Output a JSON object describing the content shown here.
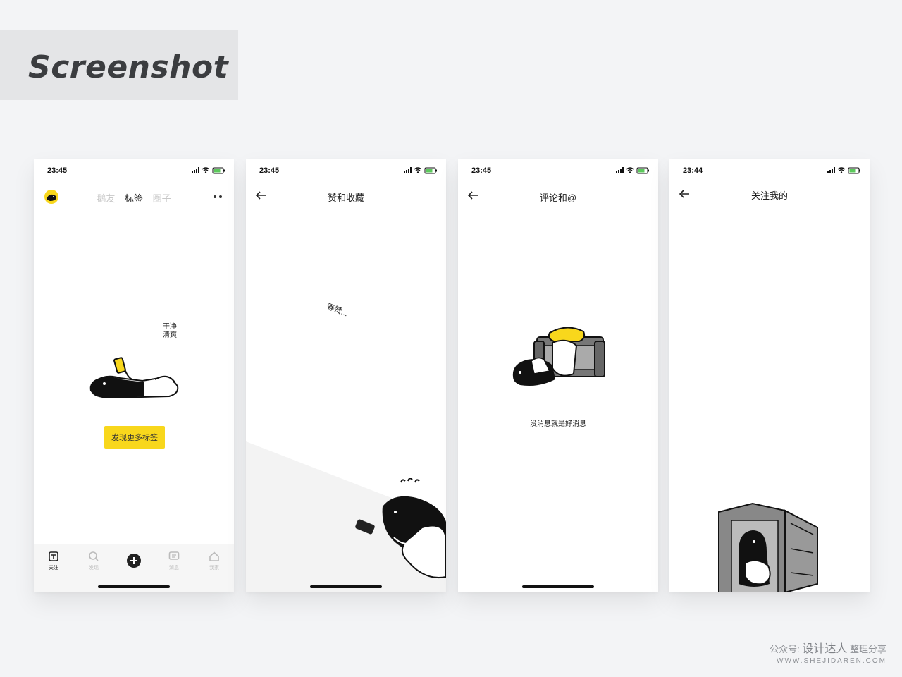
{
  "header": {
    "title": "Screenshot"
  },
  "screens": [
    {
      "status_time": "23:45",
      "tabs": [
        {
          "label": "鹅友",
          "active": false
        },
        {
          "label": "标签",
          "active": true
        },
        {
          "label": "圈子",
          "active": false
        }
      ],
      "bubble_text_1": "干净",
      "bubble_text_2": "清爽",
      "cta_label": "发现更多标签",
      "bottom_tabs": [
        {
          "label": "关注",
          "icon": "follow-icon",
          "active": true
        },
        {
          "label": "发现",
          "icon": "search-icon",
          "active": false
        },
        {
          "label": "",
          "icon": "add-icon",
          "active": false
        },
        {
          "label": "消息",
          "icon": "message-icon",
          "active": false
        },
        {
          "label": "我家",
          "icon": "home-icon",
          "active": false
        }
      ]
    },
    {
      "status_time": "23:45",
      "title": "赞和收藏",
      "floating_text": "等赞..."
    },
    {
      "status_time": "23:45",
      "title": "评论和@",
      "empty_message": "没消息就是好消息"
    },
    {
      "status_time": "23:44",
      "title": "关注我的"
    }
  ],
  "credit": {
    "prefix": "公众号:",
    "brand": "设计达人",
    "suffix": "整理分享",
    "url": "WWW.SHEJIDAREN.COM"
  },
  "colors": {
    "accent_yellow": "#f8d71c",
    "page_bg": "#f3f4f6"
  }
}
